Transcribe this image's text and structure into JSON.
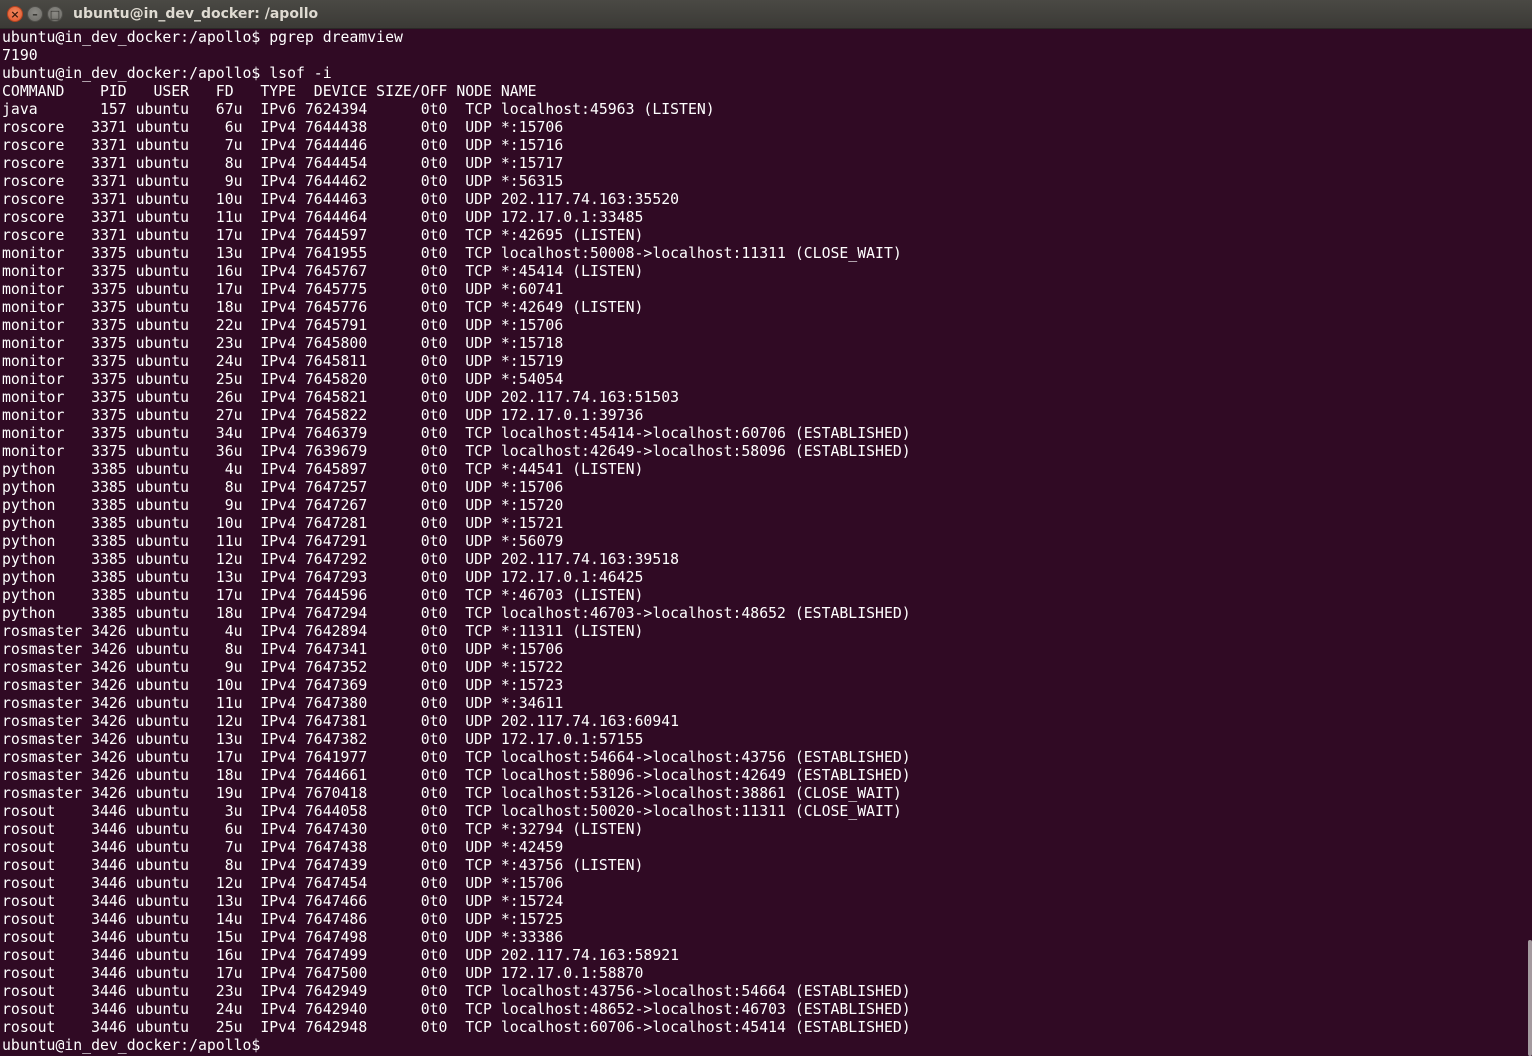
{
  "window": {
    "title": "ubuntu@in_dev_docker: /apollo",
    "close_glyph": "×",
    "minimize_glyph": "–",
    "maximize_glyph": "□",
    "colors": {
      "background": "#300a24",
      "text": "#ffffff",
      "close_button": "#e0552c"
    }
  },
  "terminal": {
    "lines": [
      "ubuntu@in_dev_docker:/apollo$ pgrep dreamview",
      "7190",
      "ubuntu@in_dev_docker:/apollo$ lsof -i",
      "COMMAND    PID   USER   FD   TYPE  DEVICE SIZE/OFF NODE NAME",
      "java       157 ubuntu   67u  IPv6 7624394      0t0  TCP localhost:45963 (LISTEN)",
      "roscore   3371 ubuntu    6u  IPv4 7644438      0t0  UDP *:15706",
      "roscore   3371 ubuntu    7u  IPv4 7644446      0t0  UDP *:15716",
      "roscore   3371 ubuntu    8u  IPv4 7644454      0t0  UDP *:15717",
      "roscore   3371 ubuntu    9u  IPv4 7644462      0t0  UDP *:56315",
      "roscore   3371 ubuntu   10u  IPv4 7644463      0t0  UDP 202.117.74.163:35520",
      "roscore   3371 ubuntu   11u  IPv4 7644464      0t0  UDP 172.17.0.1:33485",
      "roscore   3371 ubuntu   17u  IPv4 7644597      0t0  TCP *:42695 (LISTEN)",
      "monitor   3375 ubuntu   13u  IPv4 7641955      0t0  TCP localhost:50008->localhost:11311 (CLOSE_WAIT)",
      "monitor   3375 ubuntu   16u  IPv4 7645767      0t0  TCP *:45414 (LISTEN)",
      "monitor   3375 ubuntu   17u  IPv4 7645775      0t0  UDP *:60741",
      "monitor   3375 ubuntu   18u  IPv4 7645776      0t0  TCP *:42649 (LISTEN)",
      "monitor   3375 ubuntu   22u  IPv4 7645791      0t0  UDP *:15706",
      "monitor   3375 ubuntu   23u  IPv4 7645800      0t0  UDP *:15718",
      "monitor   3375 ubuntu   24u  IPv4 7645811      0t0  UDP *:15719",
      "monitor   3375 ubuntu   25u  IPv4 7645820      0t0  UDP *:54054",
      "monitor   3375 ubuntu   26u  IPv4 7645821      0t0  UDP 202.117.74.163:51503",
      "monitor   3375 ubuntu   27u  IPv4 7645822      0t0  UDP 172.17.0.1:39736",
      "monitor   3375 ubuntu   34u  IPv4 7646379      0t0  TCP localhost:45414->localhost:60706 (ESTABLISHED)",
      "monitor   3375 ubuntu   36u  IPv4 7639679      0t0  TCP localhost:42649->localhost:58096 (ESTABLISHED)",
      "python    3385 ubuntu    4u  IPv4 7645897      0t0  TCP *:44541 (LISTEN)",
      "python    3385 ubuntu    8u  IPv4 7647257      0t0  UDP *:15706",
      "python    3385 ubuntu    9u  IPv4 7647267      0t0  UDP *:15720",
      "python    3385 ubuntu   10u  IPv4 7647281      0t0  UDP *:15721",
      "python    3385 ubuntu   11u  IPv4 7647291      0t0  UDP *:56079",
      "python    3385 ubuntu   12u  IPv4 7647292      0t0  UDP 202.117.74.163:39518",
      "python    3385 ubuntu   13u  IPv4 7647293      0t0  UDP 172.17.0.1:46425",
      "python    3385 ubuntu   17u  IPv4 7644596      0t0  TCP *:46703 (LISTEN)",
      "python    3385 ubuntu   18u  IPv4 7647294      0t0  TCP localhost:46703->localhost:48652 (ESTABLISHED)",
      "rosmaster 3426 ubuntu    4u  IPv4 7642894      0t0  TCP *:11311 (LISTEN)",
      "rosmaster 3426 ubuntu    8u  IPv4 7647341      0t0  UDP *:15706",
      "rosmaster 3426 ubuntu    9u  IPv4 7647352      0t0  UDP *:15722",
      "rosmaster 3426 ubuntu   10u  IPv4 7647369      0t0  UDP *:15723",
      "rosmaster 3426 ubuntu   11u  IPv4 7647380      0t0  UDP *:34611",
      "rosmaster 3426 ubuntu   12u  IPv4 7647381      0t0  UDP 202.117.74.163:60941",
      "rosmaster 3426 ubuntu   13u  IPv4 7647382      0t0  UDP 172.17.0.1:57155",
      "rosmaster 3426 ubuntu   17u  IPv4 7641977      0t0  TCP localhost:54664->localhost:43756 (ESTABLISHED)",
      "rosmaster 3426 ubuntu   18u  IPv4 7644661      0t0  TCP localhost:58096->localhost:42649 (ESTABLISHED)",
      "rosmaster 3426 ubuntu   19u  IPv4 7670418      0t0  TCP localhost:53126->localhost:38861 (CLOSE_WAIT)",
      "rosout    3446 ubuntu    3u  IPv4 7644058      0t0  TCP localhost:50020->localhost:11311 (CLOSE_WAIT)",
      "rosout    3446 ubuntu    6u  IPv4 7647430      0t0  TCP *:32794 (LISTEN)",
      "rosout    3446 ubuntu    7u  IPv4 7647438      0t0  UDP *:42459",
      "rosout    3446 ubuntu    8u  IPv4 7647439      0t0  TCP *:43756 (LISTEN)",
      "rosout    3446 ubuntu   12u  IPv4 7647454      0t0  UDP *:15706",
      "rosout    3446 ubuntu   13u  IPv4 7647466      0t0  UDP *:15724",
      "rosout    3446 ubuntu   14u  IPv4 7647486      0t0  UDP *:15725",
      "rosout    3446 ubuntu   15u  IPv4 7647498      0t0  UDP *:33386",
      "rosout    3446 ubuntu   16u  IPv4 7647499      0t0  UDP 202.117.74.163:58921",
      "rosout    3446 ubuntu   17u  IPv4 7647500      0t0  UDP 172.17.0.1:58870",
      "rosout    3446 ubuntu   23u  IPv4 7642949      0t0  TCP localhost:43756->localhost:54664 (ESTABLISHED)",
      "rosout    3446 ubuntu   24u  IPv4 7642940      0t0  TCP localhost:48652->localhost:46703 (ESTABLISHED)",
      "rosout    3446 ubuntu   25u  IPv4 7642948      0t0  TCP localhost:60706->localhost:45414 (ESTABLISHED)"
    ],
    "prompt": "ubuntu@in_dev_docker:/apollo$"
  }
}
